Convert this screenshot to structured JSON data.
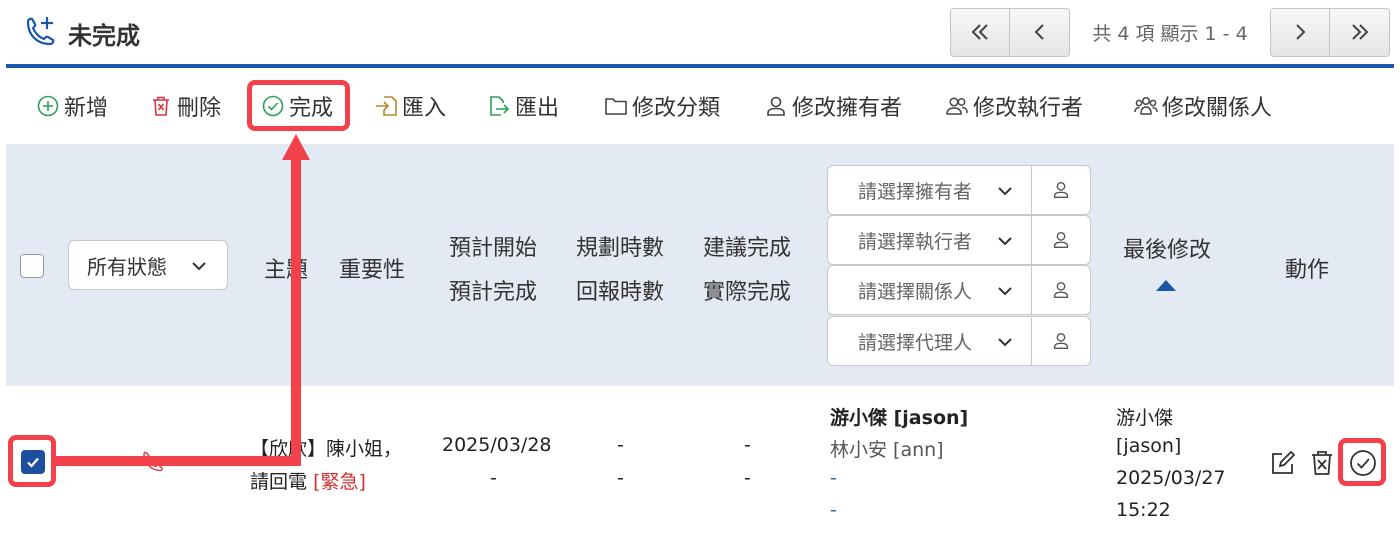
{
  "header": {
    "title": "未完成",
    "pager_info": "共 4 項 顯示 1 - 4"
  },
  "toolbar": {
    "add_label": "新增",
    "delete_label": "刪除",
    "complete_label": "完成",
    "import_label": "匯入",
    "export_label": "匯出",
    "change_category_label": "修改分類",
    "change_owner_label": "修改擁有者",
    "change_executor_label": "修改執行者",
    "change_related_label": "修改關係人"
  },
  "table_header": {
    "status_filter": "所有狀態",
    "subject": "主題",
    "importance": "重要性",
    "planned_start": "預計開始",
    "planned_finish": "預計完成",
    "planned_hours": "規劃時數",
    "reported_hours": "回報時數",
    "suggested_finish": "建議完成",
    "actual_finish": "實際完成",
    "owner_placeholder": "請選擇擁有者",
    "executor_placeholder": "請選擇執行者",
    "related_placeholder": "請選擇關係人",
    "agent_placeholder": "請選擇代理人",
    "last_modified": "最後修改",
    "actions": "動作"
  },
  "rows": [
    {
      "checked": true,
      "subject_line1": "【欣欣】陳小姐，",
      "subject_line2": "請回電",
      "subject_tag": "[緊急]",
      "planned_start": "2025/03/28",
      "planned_finish": "-",
      "planned_hours": "-",
      "reported_hours": "-",
      "suggested_finish": "-",
      "actual_finish": "-",
      "owner": "游小傑 [jason]",
      "executor": "林小安 [ann]",
      "related": "-",
      "agent": "-",
      "modified_by_name": "游小傑",
      "modified_by_id": "[jason]",
      "modified_date": "2025/03/27",
      "modified_time": "15:22"
    }
  ],
  "colors": {
    "accent_blue": "#1a57a8",
    "header_bg": "#e4eaf4",
    "annotation_red": "#f2414b",
    "urgent_red": "#d32f2f",
    "add_green": "#2e9e5b",
    "delete_red": "#d9343f"
  },
  "icons": [
    "phone-add-icon",
    "first-page-icon",
    "prev-page-icon",
    "next-page-icon",
    "last-page-icon",
    "plus-circle-icon",
    "trash-icon",
    "check-circle-icon",
    "import-icon",
    "export-icon",
    "folder-icon",
    "person-icon",
    "people-icon",
    "chevron-down-icon",
    "edit-icon"
  ]
}
